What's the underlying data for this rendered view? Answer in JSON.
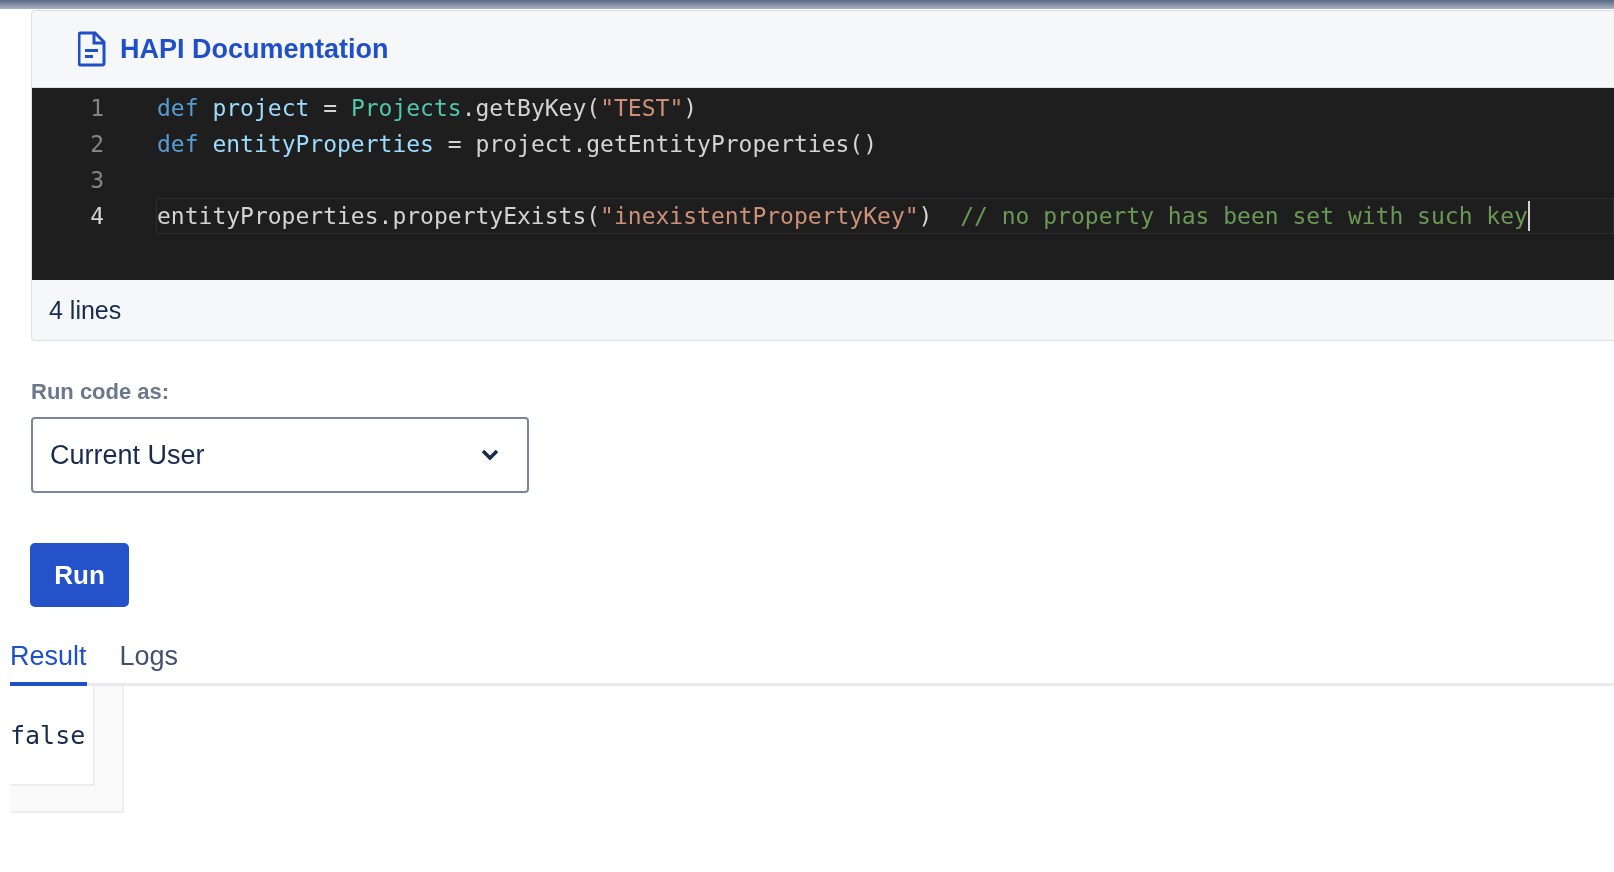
{
  "panel": {
    "title": "HAPI Documentation",
    "footer": "4 lines"
  },
  "code_lines": [
    {
      "number": "1",
      "active": false,
      "tokens": [
        {
          "kind": "keyword",
          "text": "def "
        },
        {
          "kind": "variable",
          "text": "project"
        },
        {
          "kind": "plain",
          "text": " = "
        },
        {
          "kind": "class",
          "text": "Projects"
        },
        {
          "kind": "plain",
          "text": ".getByKey("
        },
        {
          "kind": "string",
          "text": "\"TEST\""
        },
        {
          "kind": "plain",
          "text": ")"
        }
      ]
    },
    {
      "number": "2",
      "active": false,
      "tokens": [
        {
          "kind": "keyword",
          "text": "def "
        },
        {
          "kind": "variable",
          "text": "entityProperties"
        },
        {
          "kind": "plain",
          "text": " = project.getEntityProperties()"
        }
      ]
    },
    {
      "number": "3",
      "active": false
    },
    {
      "number": "4",
      "active": true,
      "tokens": [
        {
          "kind": "plain",
          "text": "entityProperties.propertyExists("
        },
        {
          "kind": "string",
          "text": "\"inexistentPropertyKey\""
        },
        {
          "kind": "plain",
          "text": ")  "
        },
        {
          "kind": "comment",
          "text": "// no property has been set with such key"
        }
      ]
    }
  ],
  "run_as": {
    "label": "Run code as:",
    "value": "Current User"
  },
  "run_button": "Run",
  "tabs": [
    {
      "label": "Result",
      "selected": true
    },
    {
      "label": "Logs",
      "selected": false
    }
  ],
  "result": "false"
}
